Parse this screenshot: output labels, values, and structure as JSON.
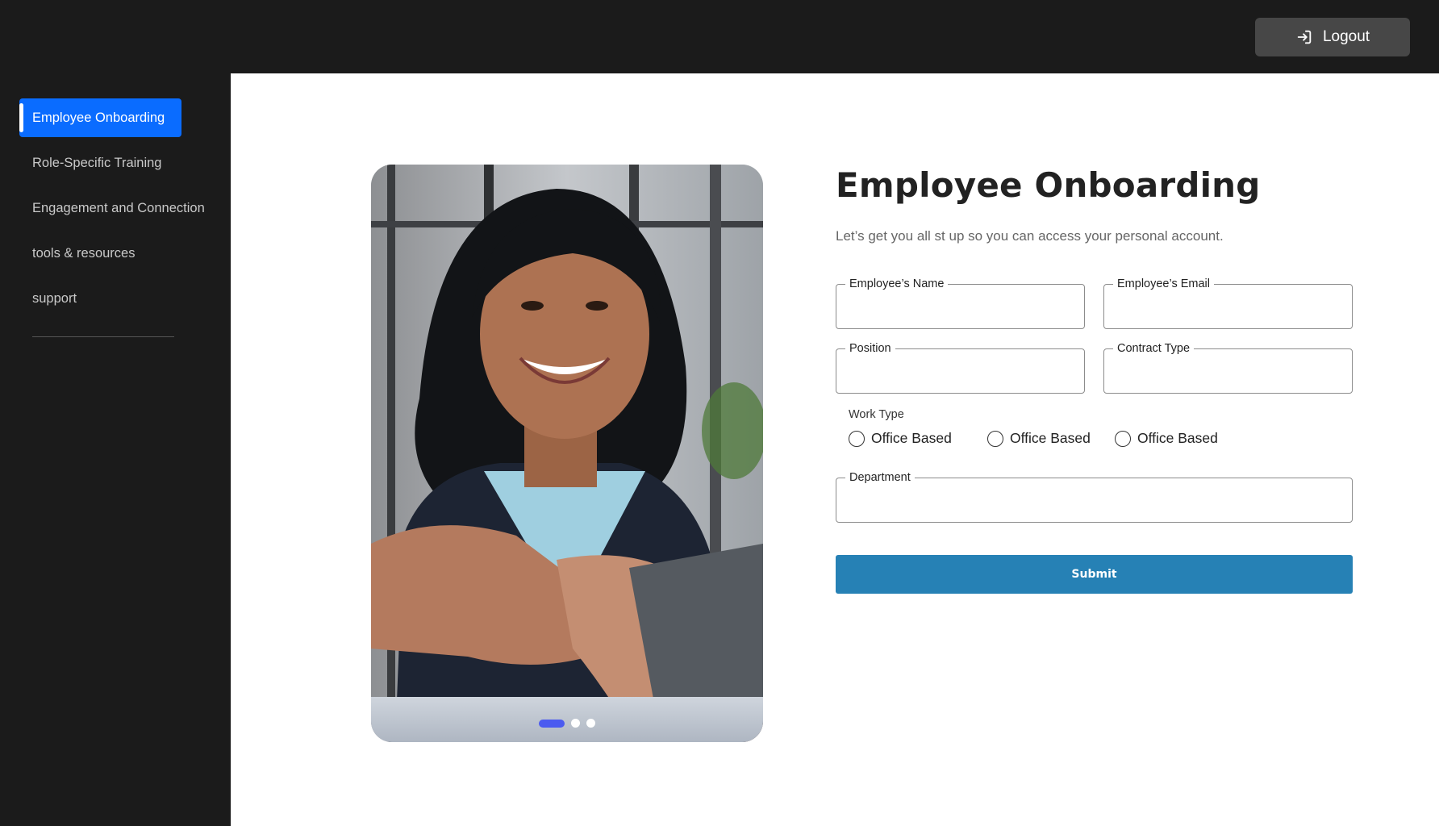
{
  "header": {
    "logout_label": "Logout",
    "logout_icon": "logout-icon"
  },
  "sidebar": {
    "items": [
      {
        "label": "Employee Onboarding",
        "active": true
      },
      {
        "label": "Role-Specific Training",
        "active": false
      },
      {
        "label": "Engagement and Connection",
        "active": false
      },
      {
        "label": "tools & resources",
        "active": false
      },
      {
        "label": "support",
        "active": false
      }
    ]
  },
  "carousel": {
    "slide_count": 3,
    "active_slide": 1
  },
  "form": {
    "title": "Employee Onboarding",
    "subtitle": "Let’s get you all st up so you can access your personal account.",
    "fields": {
      "name": {
        "label": "Employee’s Name",
        "value": ""
      },
      "email": {
        "label": "Employee’s Email",
        "value": ""
      },
      "position": {
        "label": "Position",
        "value": ""
      },
      "contract": {
        "label": "Contract Type",
        "value": ""
      },
      "department": {
        "label": "Department",
        "value": ""
      }
    },
    "work_type": {
      "label": "Work Type",
      "options": [
        "Office Based",
        "Office Based",
        "Office Based"
      ],
      "selected": null
    },
    "submit_label": "Submit"
  },
  "colors": {
    "accent_nav": "#0a6cff",
    "submit": "#2681b5",
    "dot_active": "#4b5bf0",
    "sidebar_bg": "#1b1b1b"
  }
}
